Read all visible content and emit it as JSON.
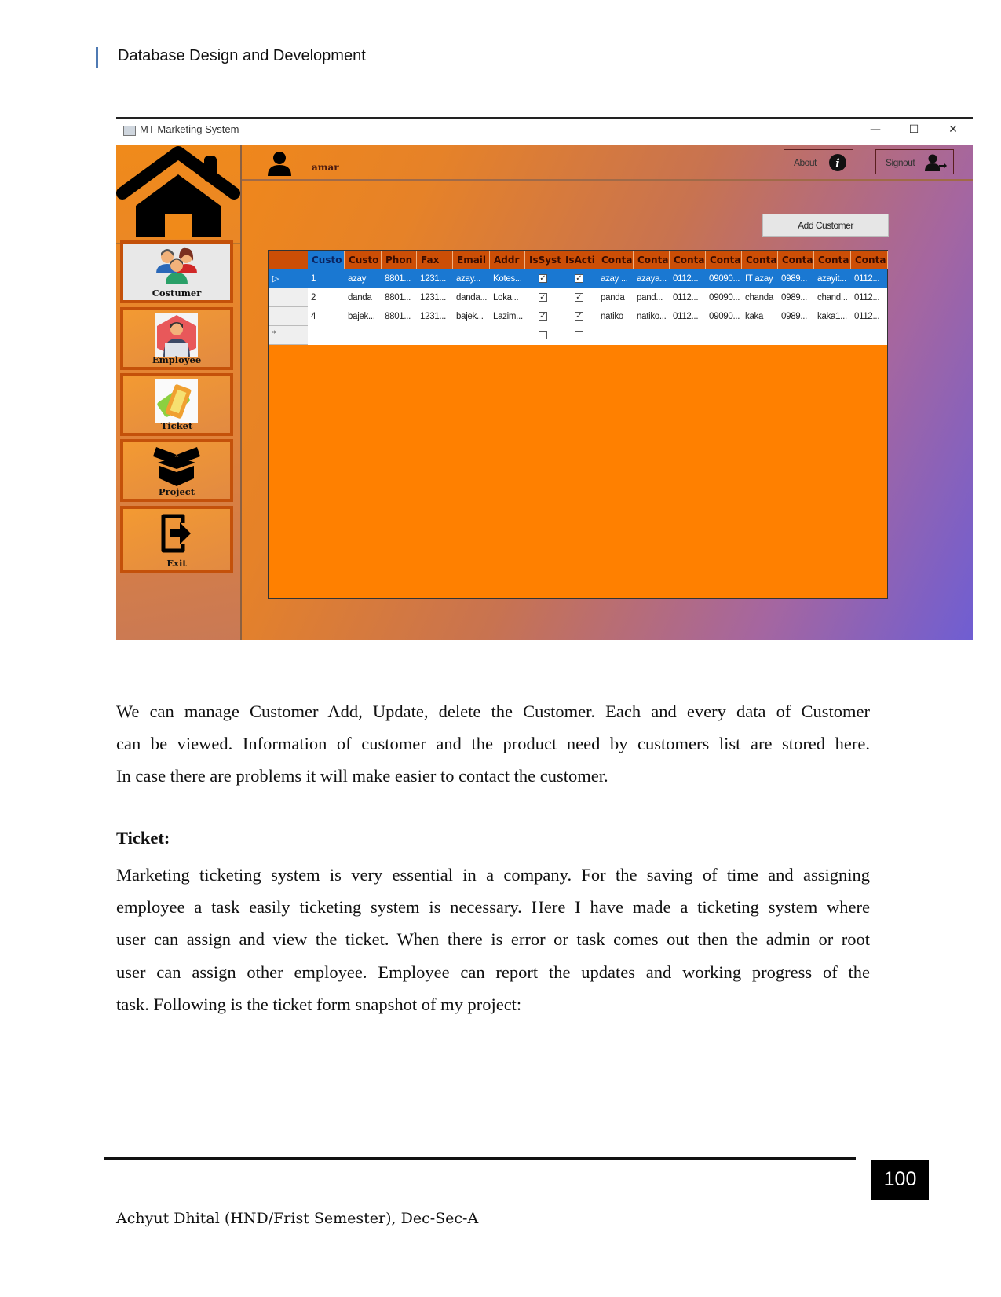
{
  "page": {
    "header_title": "Database Design and Development",
    "page_number": "100",
    "footer_text": "Achyut Dhital (HND/Frist Semester), Dec-Sec-A"
  },
  "app": {
    "window_title": "MT-Marketing System",
    "window_controls": {
      "minimize": "—",
      "maximize": "☐",
      "close": "✕"
    },
    "username": "amar",
    "about_label": "About",
    "signout_label": "Signout",
    "add_customer_label": "Add Customer",
    "colors": {
      "accent_orange": "#ff8000",
      "header_orange": "#cc4e06",
      "selection_blue": "#1a78d2",
      "gradient_purple": "#6f5ed2"
    },
    "sidebar": {
      "items": [
        {
          "label": "Costumer",
          "icon": "customers-icon",
          "active": true
        },
        {
          "label": "Employee",
          "icon": "employee-icon",
          "active": false
        },
        {
          "label": "Ticket",
          "icon": "ticket-icon",
          "active": false
        },
        {
          "label": "Project",
          "icon": "box-icon",
          "active": false
        },
        {
          "label": "Exit",
          "icon": "exit-icon",
          "active": false
        }
      ]
    },
    "grid": {
      "columns": [
        "Custo",
        "Custo",
        "Phon",
        "Fax",
        "Email",
        "Addr",
        "IsSyst",
        "IsActi",
        "Conta",
        "Conta",
        "Conta",
        "Conta",
        "Conta",
        "Conta",
        "Conta",
        "Conta"
      ],
      "rows": [
        {
          "selected": true,
          "marker": "▷",
          "cells": [
            "1",
            "azay",
            "8801...",
            "1231...",
            "azay...",
            "Kotes...",
            true,
            true,
            "azay ...",
            "azaya...",
            "0112...",
            "09090...",
            "IT azay",
            "0989...",
            "azayit...",
            "0112..."
          ]
        },
        {
          "selected": false,
          "marker": "",
          "cells": [
            "2",
            "danda",
            "8801...",
            "1231...",
            "danda...",
            "Loka...",
            true,
            true,
            "panda",
            "pand...",
            "0112...",
            "09090...",
            "chanda",
            "0989...",
            "chand...",
            "0112..."
          ]
        },
        {
          "selected": false,
          "marker": "",
          "cells": [
            "4",
            "bajek...",
            "8801...",
            "1231...",
            "bajek...",
            "Lazim...",
            true,
            true,
            "natiko",
            "natiko...",
            "0112...",
            "09090...",
            "kaka",
            "0989...",
            "kaka1...",
            "0112..."
          ]
        },
        {
          "selected": false,
          "marker": "*",
          "cells": [
            "",
            "",
            "",
            "",
            "",
            "",
            false,
            false,
            "",
            "",
            "",
            "",
            "",
            "",
            "",
            ""
          ]
        }
      ]
    }
  },
  "body": {
    "para1_lines": [
      "We can manage Customer Add, Update, delete the Customer. Each and every data of Customer",
      "can be viewed. Information of customer and the product need by customers list are stored here.",
      "In case there are problems it will make easier to contact the customer."
    ],
    "section_heading": "Ticket:",
    "para2_lines": [
      "Marketing ticketing system is very essential in a company. For the saving of time and assigning",
      "employee a task easily ticketing system is necessary. Here I have made a ticketing system where",
      "user can assign and view the ticket. When there is error or task comes out then the admin or root",
      "user can assign other employee. Employee can report the updates and working progress of the",
      "task. Following is the ticket form snapshot of my project:"
    ]
  }
}
